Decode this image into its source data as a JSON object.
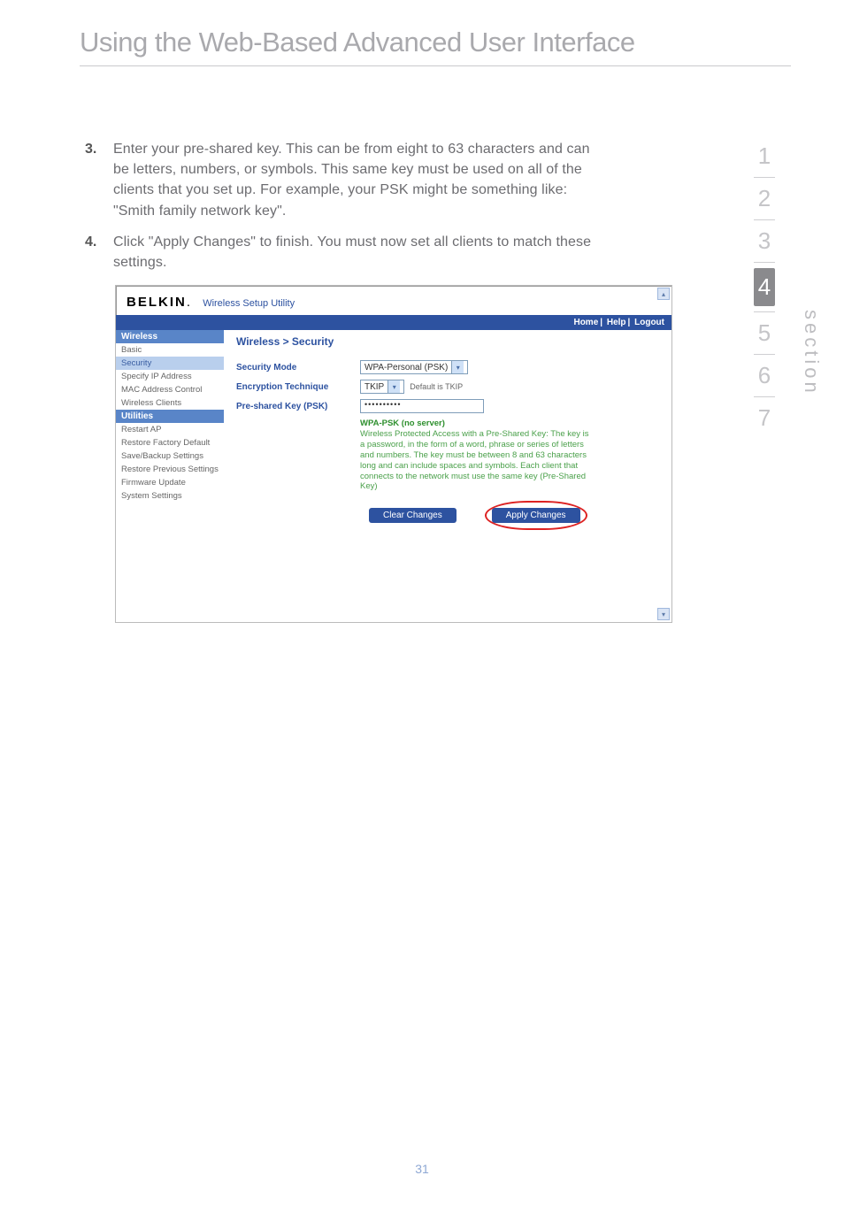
{
  "page": {
    "title": "Using the Web-Based Advanced User Interface",
    "number": "31"
  },
  "rail": {
    "label": "section",
    "items": [
      "1",
      "2",
      "3",
      "4",
      "5",
      "6",
      "7"
    ],
    "active_index": 3
  },
  "steps": [
    {
      "num": "3.",
      "text": "Enter your pre-shared key. This can be from eight to 63 characters and can be letters, numbers, or symbols. This same key must be used on all of the clients that you set up. For example, your PSK might be something like: \"Smith family network key\"."
    },
    {
      "num": "4.",
      "text": "Click \"Apply Changes\" to finish. You must now set all clients to match these settings."
    }
  ],
  "utility": {
    "brand": "BELKIN",
    "brand_sub": "Wireless Setup Utility",
    "topbar": {
      "home": "Home",
      "help": "Help",
      "logout": "Logout"
    },
    "sidebar": {
      "group1": "Wireless",
      "items1": [
        "Basic",
        "Security",
        "Specify IP Address",
        "MAC Address Control",
        "Wireless Clients"
      ],
      "group2": "Utilities",
      "items2": [
        "Restart AP",
        "Restore Factory Default",
        "Save/Backup Settings",
        "Restore Previous Settings",
        "Firmware Update",
        "System Settings"
      ]
    },
    "crumb": "Wireless > Security",
    "rows": {
      "mode_label": "Security Mode",
      "mode_value": "WPA-Personal (PSK)",
      "enc_label": "Encryption Technique",
      "enc_value": "TKIP",
      "enc_hint": "Default is TKIP",
      "psk_label": "Pre-shared Key (PSK)",
      "psk_value": "••••••••••"
    },
    "desc": {
      "title": "WPA-PSK (no server)",
      "body": "Wireless Protected Access with a Pre-Shared Key: The key is a password, in the form of a word, phrase or series of letters and numbers. The key must be between 8 and 63 characters long and can include spaces and symbols. Each client that connects to the network must use the same key (Pre-Shared Key)"
    },
    "buttons": {
      "clear": "Clear Changes",
      "apply": "Apply Changes"
    }
  }
}
